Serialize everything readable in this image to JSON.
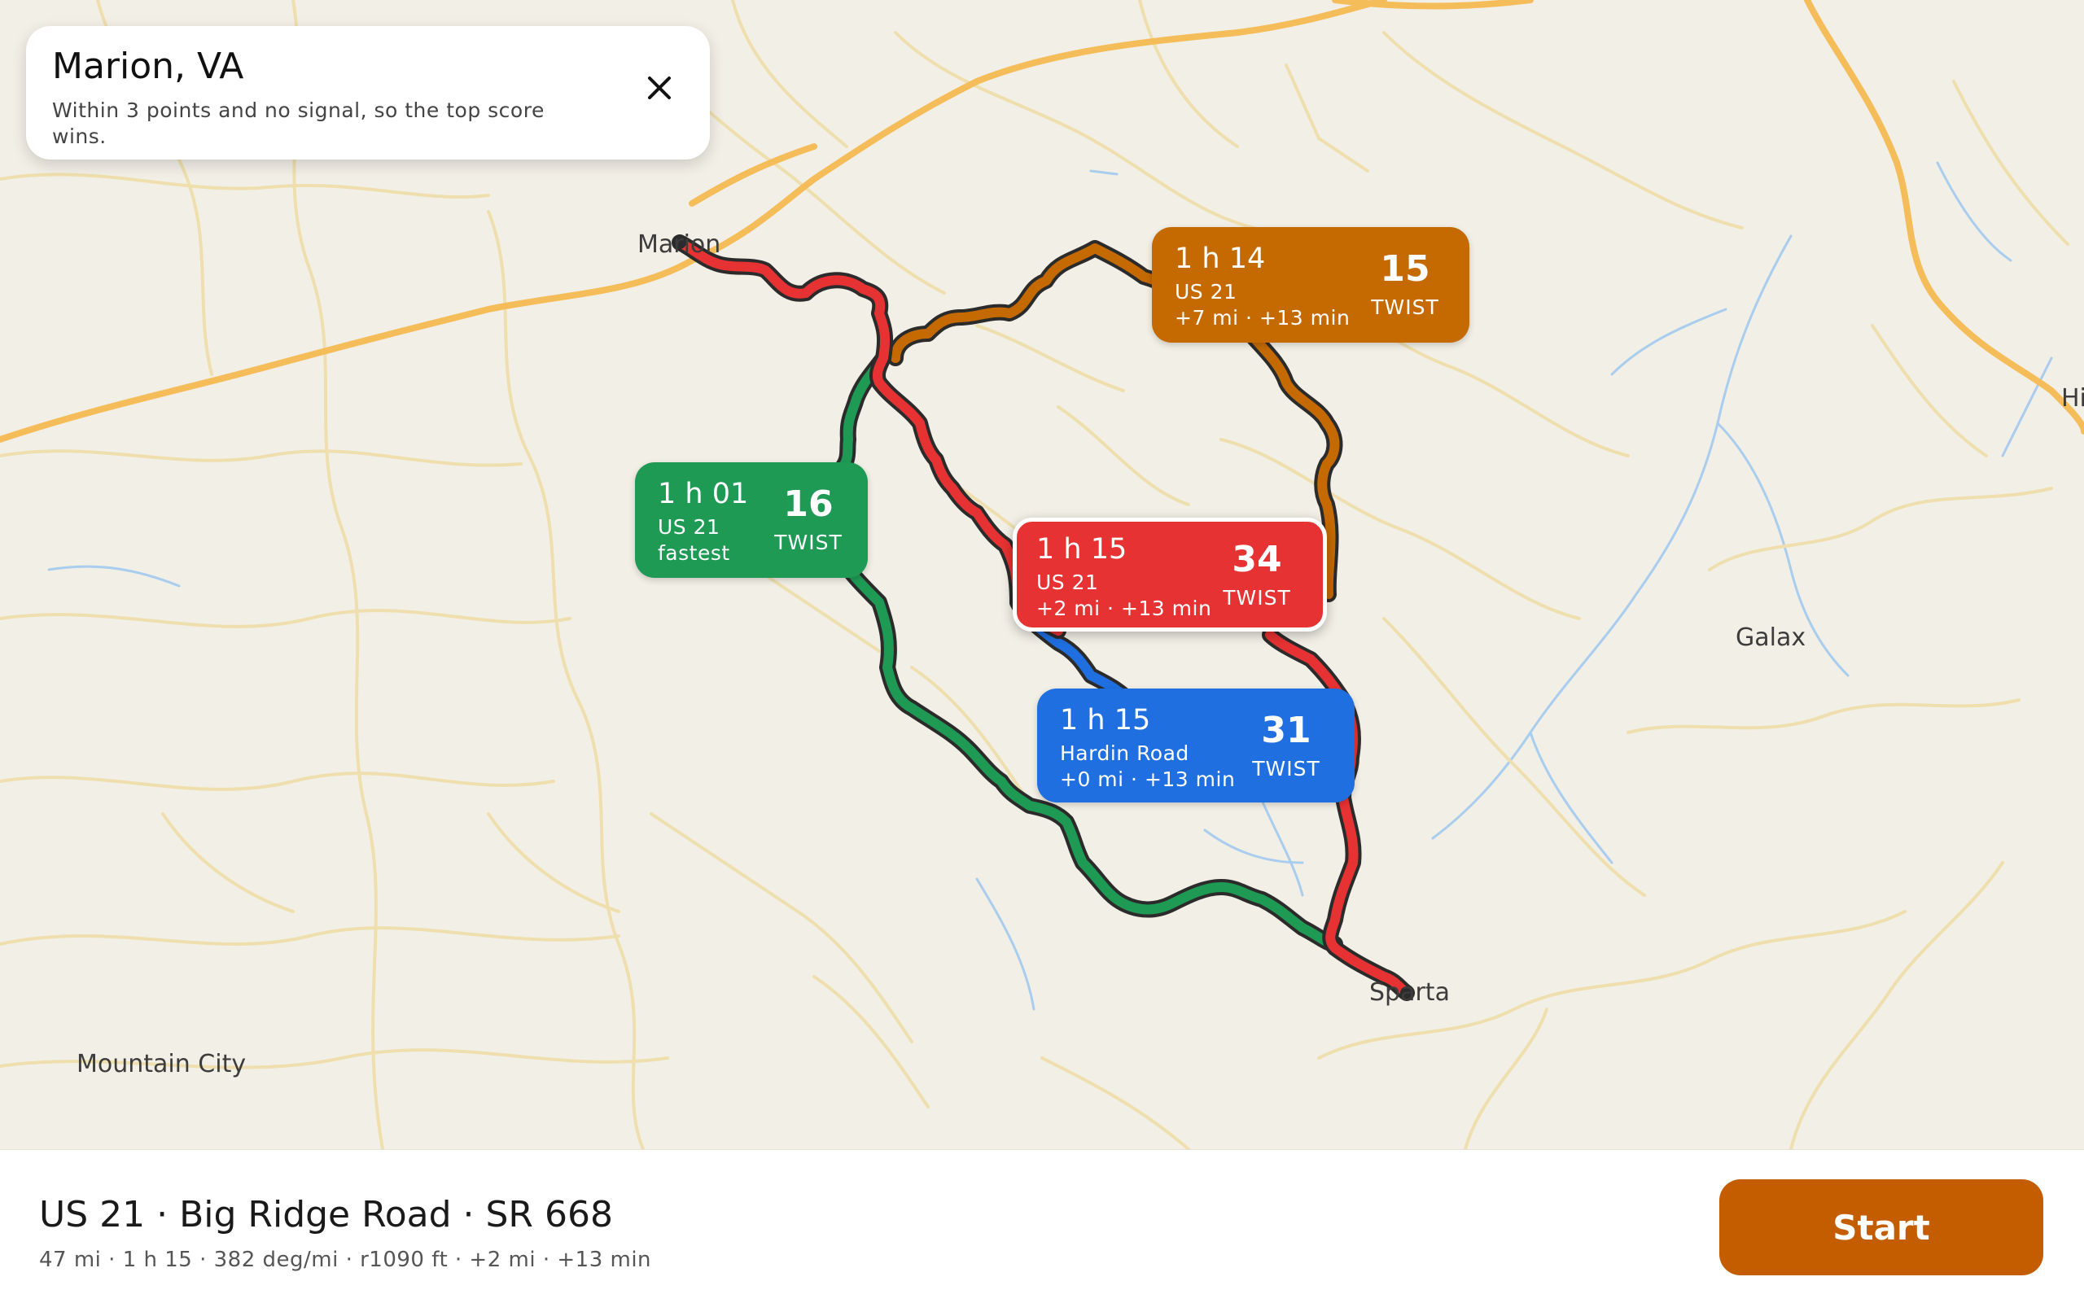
{
  "header": {
    "title": "Marion, VA",
    "subtitle": "Within 3 points and no signal, so the top score wins.",
    "close_icon": "close-icon"
  },
  "places": {
    "marion": "Marion",
    "sparta": "Sparta",
    "galax": "Galax",
    "mountain_city": "Mountain City",
    "edge": "Hi"
  },
  "routes": [
    {
      "id": "green",
      "color": "#1f9a55",
      "time": "1 h 01",
      "road": "US 21",
      "meta": "fastest",
      "score": "16",
      "score_label": "TWIST",
      "selected": false
    },
    {
      "id": "orange",
      "color": "#c46a00",
      "time": "1 h 14",
      "road": "US 21",
      "meta": "+7 mi · +13 min",
      "score": "15",
      "score_label": "TWIST",
      "selected": false
    },
    {
      "id": "red",
      "color": "#e63232",
      "time": "1 h 15",
      "road": "US 21",
      "meta": "+2 mi · +13 min",
      "score": "34",
      "score_label": "TWIST",
      "selected": true
    },
    {
      "id": "blue",
      "color": "#1f6fe0",
      "time": "1 h 15",
      "road": "Hardin Road",
      "meta": "+0 mi · +13 min",
      "score": "31",
      "score_label": "TWIST",
      "selected": false
    }
  ],
  "bottom": {
    "title": "US 21 · Big Ridge Road · SR 668",
    "subtitle": "47 mi · 1 h 15 · 382 deg/mi · r1090 ft · +2 mi · +13 min",
    "start_label": "Start",
    "accent_color": "#c45c00"
  },
  "map_colors": {
    "land": "#f2efe6",
    "water": "#a9cdee",
    "highway": "#f5bd5a",
    "minor_road": "#efdfae"
  }
}
